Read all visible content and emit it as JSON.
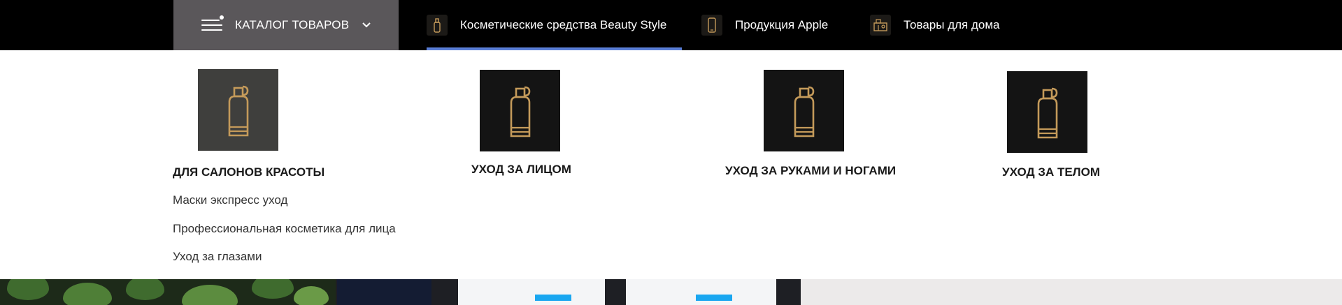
{
  "topnav": {
    "catalog_label": "КАТАЛОГ ТОВАРОВ",
    "tabs": [
      {
        "label": "Косметические средства Beauty Style",
        "icon": "spray-bottle-icon",
        "active": true
      },
      {
        "label": "Продукция Apple",
        "icon": "smartphone-icon",
        "active": false
      },
      {
        "label": "Товары для дома",
        "icon": "home-goods-icon",
        "active": false
      }
    ],
    "colors": {
      "bar": "#000000",
      "catalog_bg": "#5a575a",
      "active_underline": "#5b7fd8",
      "icon_gold": "#c49a5a"
    }
  },
  "mega_menu": {
    "categories": [
      {
        "title": "ДЛЯ САЛОНОВ КРАСОТЫ",
        "icon": "spray-bottle-icon",
        "subitems": [
          "Маски экспресс уход",
          "Профессиональная косметика для лица",
          "Уход за глазами"
        ]
      },
      {
        "title": "УХОД ЗА ЛИЦОМ",
        "icon": "spray-bottle-icon"
      },
      {
        "title": "УХОД ЗА РУКАМИ И НОГАМИ",
        "icon": "spray-bottle-icon"
      },
      {
        "title": "УХОД ЗА ТЕЛОМ",
        "icon": "spray-bottle-icon"
      }
    ]
  }
}
